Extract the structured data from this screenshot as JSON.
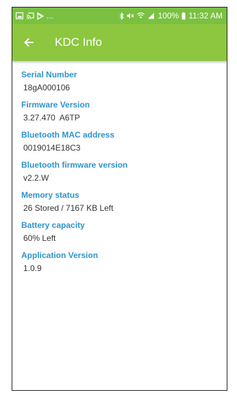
{
  "status_bar": {
    "battery_percent": "100%",
    "time": "11:32 AM",
    "notifications_more": "...",
    "left_icons": [
      "image-icon",
      "cast-icon",
      "play-store-icon"
    ],
    "right_icons": [
      "bluetooth-icon",
      "mute-icon",
      "wifi-icon",
      "signal-icon",
      "battery-icon"
    ]
  },
  "app_bar": {
    "title": "KDC Info",
    "back_icon": "arrow-left-icon",
    "color": "#8dc63f"
  },
  "fields": [
    {
      "label": "Serial Number",
      "value": "18gA000106"
    },
    {
      "label": "Firmware Version",
      "value": "3.27.470  A6TP"
    },
    {
      "label": "Bluetooth MAC address",
      "value": "0019014E18C3"
    },
    {
      "label": "Bluetooth firmware version",
      "value": "v2.2.W"
    },
    {
      "label": "Memory status",
      "value": "26 Stored / 7167 KB Left"
    },
    {
      "label": "Battery capacity",
      "value": "60% Left"
    },
    {
      "label": "Application Version",
      "value": "1.0.9"
    }
  ],
  "colors": {
    "label": "#2e93cc",
    "value": "#333333"
  }
}
